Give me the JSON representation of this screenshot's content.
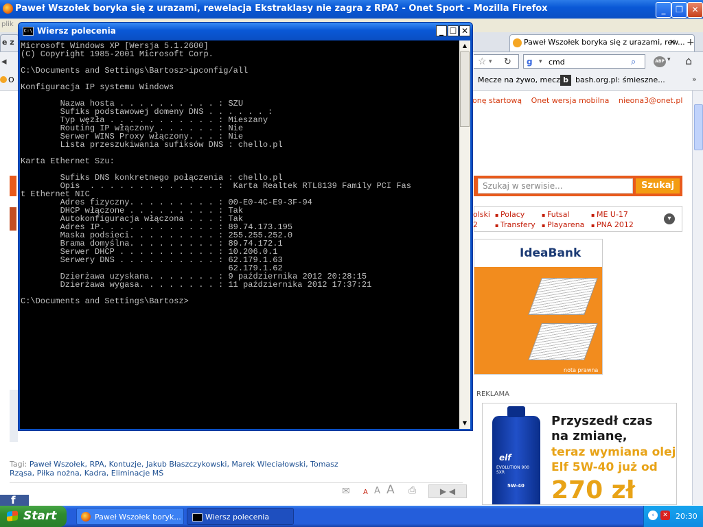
{
  "firefox": {
    "title": "Paweł Wszołek boryka się z urazami, rewelacja Ekstraklasy nie zagra z RPA? - Onet Sport - Mozilla Firefox",
    "tab_active": "Paweł Wszołek boryka się z urazami, rew...",
    "tab_left_fragment": "e z",
    "menu_fragment": "plik",
    "search_value": "cmd",
    "bookmarks": [
      "Mecze na żywo, mecz...",
      "bash.org.pl: śmieszne..."
    ],
    "bookmark_left_fragment": "O"
  },
  "page": {
    "top_links": [
      "onę startową",
      "Onet wersja mobilna",
      "nieona3@onet.pl"
    ],
    "search_placeholder": "Szukaj w serwisie...",
    "search_button": "Szukaj",
    "categories": [
      {
        "label": "olski",
        "bullet": false
      },
      {
        "label": "Polacy",
        "bullet": true
      },
      {
        "label": "Futsal",
        "bullet": true
      },
      {
        "label": "ME U-17",
        "bullet": true
      },
      {
        "label": "2",
        "bullet": false
      },
      {
        "label": "Transfery",
        "bullet": true
      },
      {
        "label": "Playarena",
        "bullet": true
      },
      {
        "label": "PNA 2012",
        "bullet": true
      }
    ],
    "ad1_brand": "IdeaBank",
    "ad1_note": "nota prawna",
    "reklama_label": "REKLAMA",
    "ad2_line1": "Przyszedł czas",
    "ad2_line2": "na zmianę,",
    "ad2_line3": "teraz wymiana oleju",
    "ad2_line4": "Elf 5W-40 już od",
    "ad2_price": "270 zł",
    "bottle_brand": "elf",
    "bottle_model": "EVOLUTION 900 SXR",
    "bottle_grade": "5W-40",
    "tags_label": "Tagi:",
    "tags_line1": "Paweł Wszołek, RPA, Kontuzje, Jakub Błaszczykowski, Marek Wleciałowski, Tomasz",
    "tags_line2": "Rząsa, Piłka nożna, Kadra, Eliminacje MŚ",
    "font_sizes": [
      "A",
      "A",
      "A"
    ],
    "fb_letter": "f"
  },
  "cmd": {
    "title": "Wiersz polecenia",
    "icon_text": "C:\\",
    "lines": [
      "Microsoft Windows XP [Wersja 5.1.2600]",
      "(C) Copyright 1985-2001 Microsoft Corp.",
      "",
      "C:\\Documents and Settings\\Bartosz>ipconfig/all",
      "",
      "Konfiguracja IP systemu Windows",
      "",
      "        Nazwa hosta . . . . . . . . . . : SZU",
      "        Sufiks podstawowej domeny DNS . . . . . . :",
      "        Typ węzła . . . . . . . . . . . : Mieszany",
      "        Routing IP włączony . . . . . . : Nie",
      "        Serwer WINS Proxy włączony. . . : Nie",
      "        Lista przeszukiwania sufiksów DNS : chello.pl",
      "",
      "Karta Ethernet Szu:",
      "",
      "        Sufiks DNS konkretnego połączenia : chello.pl",
      "        Opis  . . . . . . . . . . . . . :  Karta Realtek RTL8139 Family PCI Fas",
      "t Ethernet NIC",
      "        Adres fizyczny. . . . . . . . . : 00-E0-4C-E9-3F-94",
      "        DHCP włączone . . . . . . . . . : Tak",
      "        Autokonfiguracja włączona . . . : Tak",
      "        Adres IP. . . . . . . . . . . . : 89.74.173.195",
      "        Maska podsieci. . . . . . . . . : 255.255.252.0",
      "        Brama domyślna. . . . . . . . . : 89.74.172.1",
      "        Serwer DHCP . . . . . . . . . . : 10.206.0.1",
      "        Serwery DNS . . . . . . . . . . : 62.179.1.63",
      "                                          62.179.1.62",
      "        Dzierżawa uzyskana. . . . . . . : 9 października 2012 20:28:15",
      "        Dzierżawa wygasa. . . . . . . . : 11 października 2012 17:37:21",
      "",
      "C:\\Documents and Settings\\Bartosz>"
    ]
  },
  "taskbar": {
    "start": "Start",
    "items": [
      "Paweł Wszołek boryk...",
      "Wiersz polecenia"
    ],
    "clock": "20:30"
  }
}
